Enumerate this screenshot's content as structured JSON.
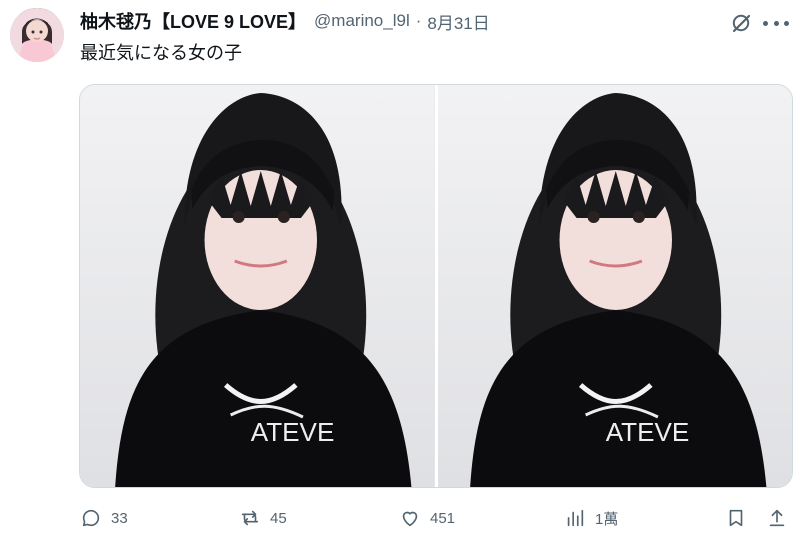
{
  "author": {
    "display_name": "柚木毬乃【LOVE 9 LOVE】",
    "handle": "@marino_l9l",
    "separator": "·",
    "date": "8月31日"
  },
  "post": {
    "text": "最近気になる女の子"
  },
  "media": {
    "photo_count": 2
  },
  "metrics": {
    "replies": "33",
    "reposts": "45",
    "likes": "451",
    "views": "1萬"
  },
  "icons": {
    "avatar": "avatar",
    "grok": "grok-icon",
    "more": "more-icon",
    "reply": "reply-icon",
    "repost": "repost-icon",
    "like": "heart-icon",
    "views": "analytics-icon",
    "bookmark": "bookmark-icon",
    "share": "share-icon"
  }
}
